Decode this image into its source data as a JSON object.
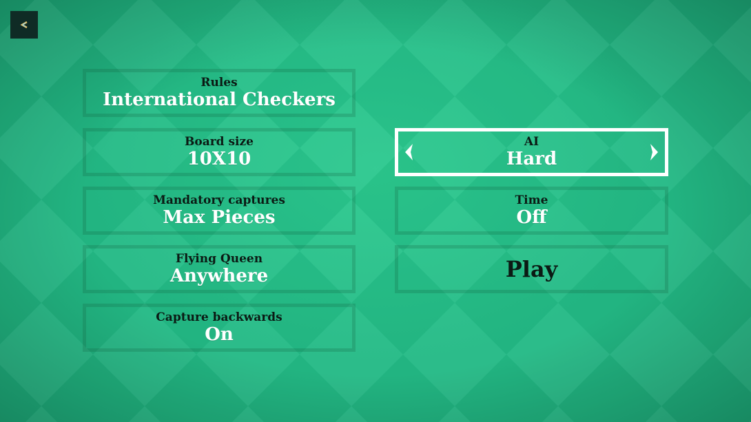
{
  "back_button": {
    "icon": "back-arrow-icon"
  },
  "options": {
    "rules": {
      "label": "Rules",
      "value": "International Checkers"
    },
    "board_size": {
      "label": "Board size",
      "value": "10X10"
    },
    "mandatory_captures": {
      "label": "Mandatory captures",
      "value": "Max Pieces"
    },
    "flying_queen": {
      "label": "Flying Queen",
      "value": "Anywhere"
    },
    "capture_backwards": {
      "label": "Capture backwards",
      "value": "On"
    },
    "ai": {
      "label": "AI",
      "value": "Hard"
    },
    "time": {
      "label": "Time",
      "value": "Off"
    }
  },
  "play": {
    "label": "Play"
  },
  "colors": {
    "background": "#23b985",
    "label": "#0b1a14",
    "value": "#ffffff",
    "back_button": "#0f2b25",
    "selected_border": "#ffffff"
  }
}
